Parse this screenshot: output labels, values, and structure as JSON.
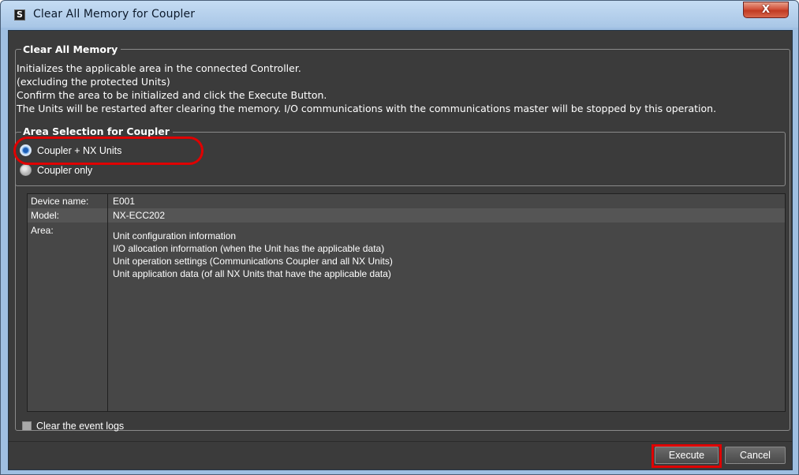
{
  "window": {
    "title": "Clear All Memory for Coupler",
    "close_label": "X",
    "app_icon_glyph": "S"
  },
  "clear_all_memory": {
    "legend": "Clear All Memory",
    "lines": [
      "Initializes the applicable area in the connected Controller.",
      "(excluding the protected Units)",
      "Confirm the area to be initialized and click the Execute Button.",
      "The Units will be restarted after clearing the memory. I/O communications with the communications master will be stopped by this operation."
    ]
  },
  "area_selection": {
    "legend": "Area Selection for Coupler",
    "options": [
      {
        "label": "Coupler + NX Units",
        "selected": true
      },
      {
        "label": "Coupler only",
        "selected": false
      }
    ]
  },
  "info": {
    "device_name_label": "Device name:",
    "device_name_value": "E001",
    "model_label": "Model:",
    "model_value": "NX-ECC202",
    "area_label": "Area:",
    "area_values": [
      "Unit configuration information",
      "I/O allocation information (when the Unit has the applicable data)",
      "Unit operation settings (Communications Coupler and all NX Units)",
      "Unit application data (of all NX Units that have the applicable data)"
    ]
  },
  "event_logs": {
    "label": "Clear the event logs",
    "checked": false
  },
  "buttons": {
    "execute": "Execute",
    "cancel": "Cancel"
  },
  "colors": {
    "highlight": "#e00000",
    "panel_bg": "#3b3b3b",
    "title_bar": "#a8c6e6"
  }
}
